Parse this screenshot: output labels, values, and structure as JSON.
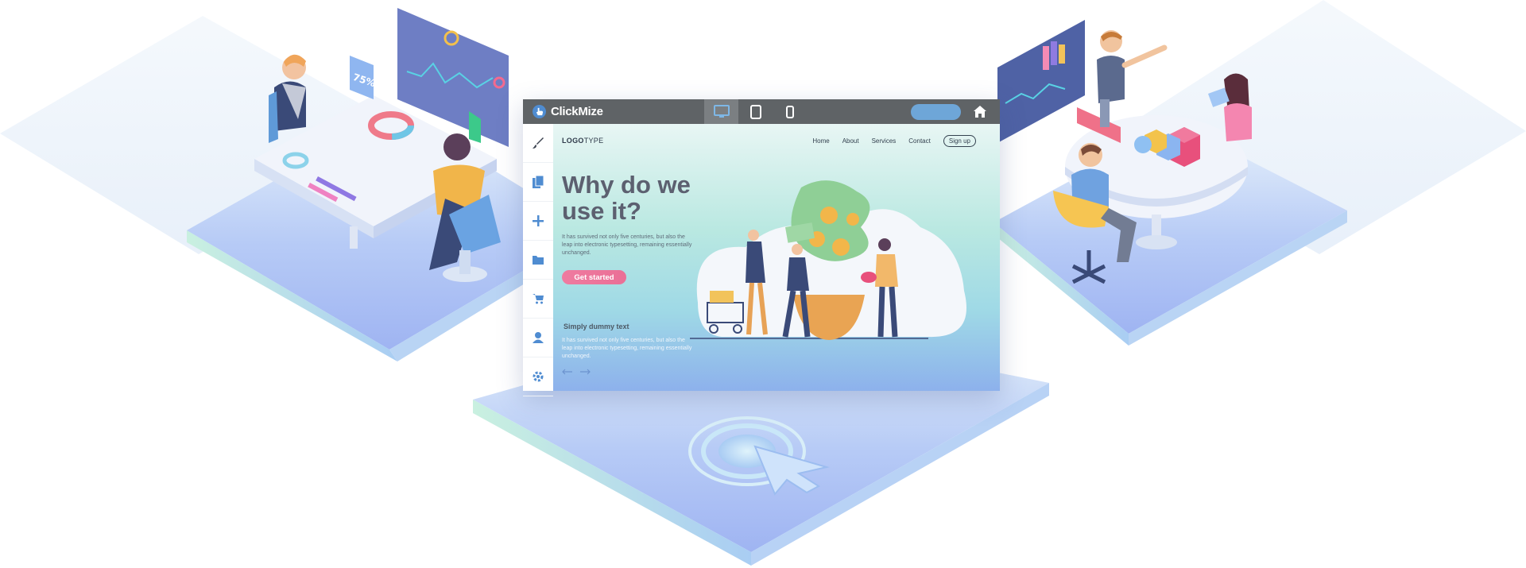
{
  "app": {
    "brand": "ClickMize",
    "devices": [
      {
        "name": "desktop",
        "active": true
      },
      {
        "name": "tablet",
        "active": false
      },
      {
        "name": "mobile",
        "active": false
      }
    ]
  },
  "tools": [
    "brush-icon",
    "pages-icon",
    "add-icon",
    "folder-icon",
    "cart-icon",
    "user-icon",
    "settings-icon"
  ],
  "site": {
    "logotype_bold": "LOGO",
    "logotype_rest": "TYPE",
    "nav": [
      "Home",
      "About",
      "Services",
      "Contact"
    ],
    "signup": "Sign up",
    "hero_title": "Why do we use it?",
    "hero_text": "It has survived not only five centuries, but also the leap into electronic typesetting, remaining essentially unchanged.",
    "cta": "Get started",
    "sub_title": "Simply dummy text",
    "sub_text": "It has survived not only five centuries, but also the leap into electronic typesetting, remaining essentially unchanged."
  },
  "decor": {
    "percent_badge": "75%"
  },
  "colors": {
    "topbar": "#5f6366",
    "accent_blue": "#6ea6d8",
    "cta_pink": "#ea6f96",
    "platform_blue": "#a9c0f5",
    "platform_mint": "#bdebd8"
  }
}
